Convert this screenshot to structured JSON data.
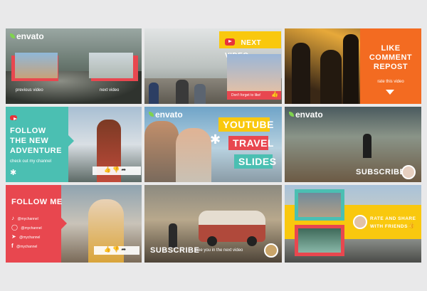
{
  "brand": "envato",
  "tile1": {
    "left_label": "previous video",
    "right_label": "next video"
  },
  "tile2": {
    "badge": "NEXT VIDEO",
    "caption": "Don't forget to like!"
  },
  "tile3": {
    "line1": "LIKE",
    "line2": "COMMENT",
    "line3": "REPOST",
    "sub": "rate this video"
  },
  "tile4": {
    "line1": "FOLLOW",
    "line2": "THE NEW",
    "line3": "ADVENTURE",
    "sub": "check out my channel"
  },
  "tile5": {
    "line1": "YOUTUBE",
    "line2": "TRAVEL",
    "line3": "SLIDES"
  },
  "tile6": {
    "label": "SUBSCRIBE"
  },
  "tile7": {
    "title": "FOLLOW ME",
    "handles": [
      "@mychannel",
      "@mychannel",
      "@mychannel",
      "@mychannel"
    ]
  },
  "tile8": {
    "label": "SUBSCRIBE",
    "sub": "see you in the next video"
  },
  "tile9": {
    "line1": "RATE AND SHARE",
    "line2": "WITH FRIENDS"
  },
  "colors": {
    "red": "#e8474f",
    "teal": "#4bbfb2",
    "yellow": "#f9c80e",
    "orange": "#f36b21"
  }
}
